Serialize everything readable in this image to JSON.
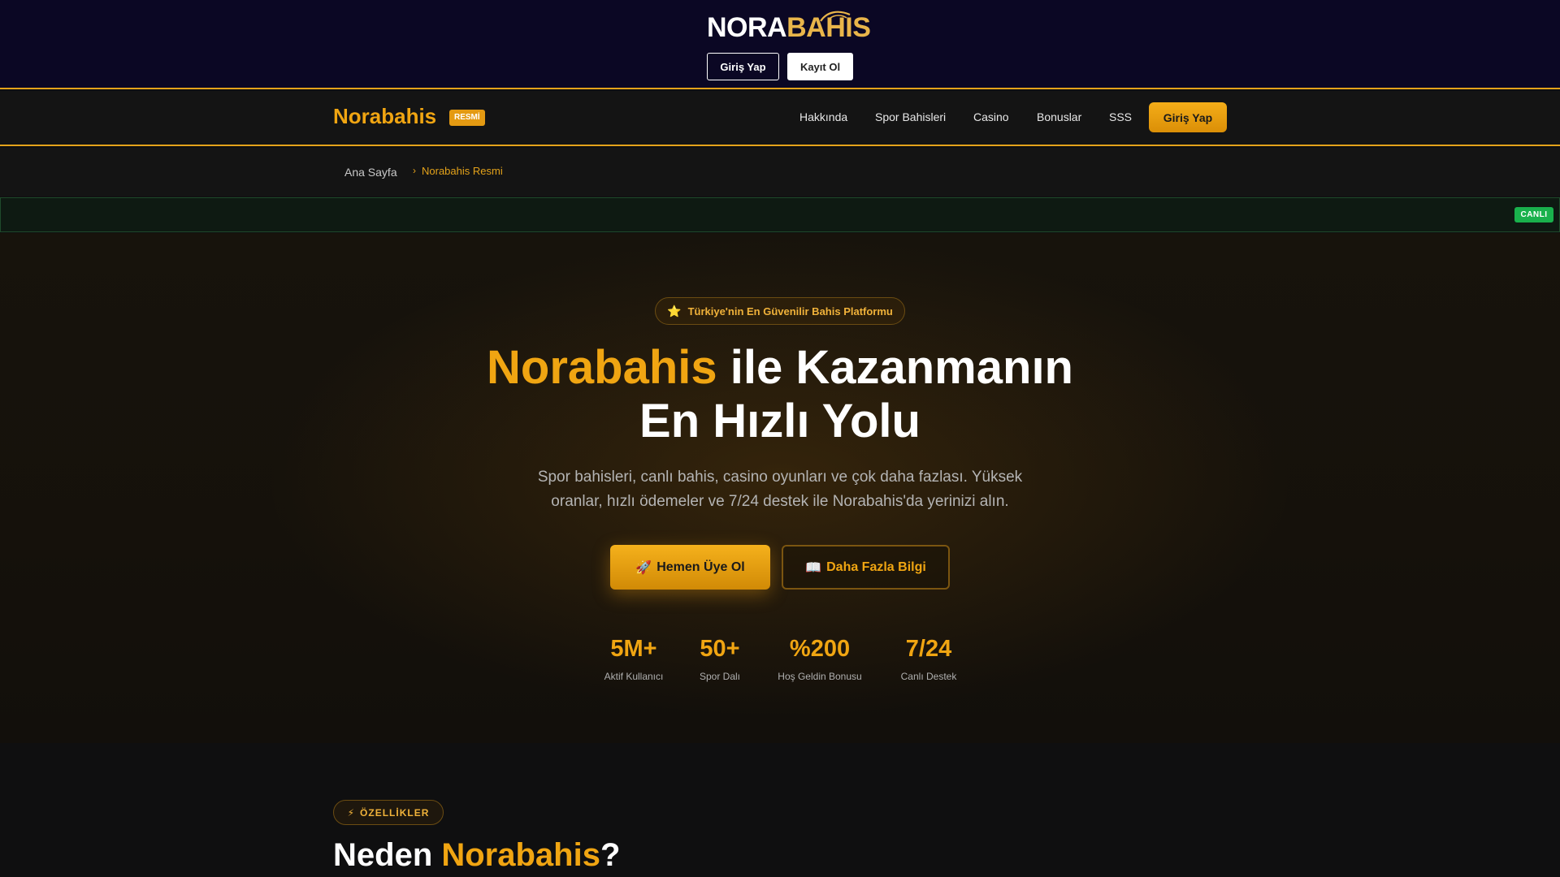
{
  "brand": {
    "logo_left": "NORA",
    "logo_right": "BAHIS",
    "login_label": "Giriş Yap",
    "register_label": "Kayıt Ol"
  },
  "nav": {
    "site_title": "Norabahis",
    "badge": "RESMİ",
    "links": [
      "Hakkında",
      "Spor Bahisleri",
      "Casino",
      "Bonuslar",
      "SSS"
    ],
    "cta_label": "Giriş Yap"
  },
  "breadcrumb": {
    "home": "Ana Sayfa",
    "separator": "›",
    "current": "Norabahis Resmi"
  },
  "ticker": {
    "live_badge": "CANLI"
  },
  "hero": {
    "pill_icon": "⭐",
    "pill_text": "Türkiye'nin En Güvenilir Bahis Platformu",
    "title_accent": "Norabahis",
    "title_line1_rest": " ile Kazanmanın",
    "title_line2": "En Hızlı Yolu",
    "subtitle": "Spor bahisleri, canlı bahis, casino oyunları ve çok daha fazlası. Yüksek oranlar, hızlı ödemeler ve 7/24 destek ile Norabahis'da yerinizi alın.",
    "primary_icon": "🚀",
    "primary_label": "Hemen Üye Ol",
    "secondary_icon": "📖",
    "secondary_label": "Daha Fazla Bilgi",
    "stats": [
      {
        "value": "5M+",
        "label": "Aktif Kullanıcı"
      },
      {
        "value": "50+",
        "label": "Spor Dalı"
      },
      {
        "value": "%200",
        "label": "Hoş Geldin Bonusu"
      },
      {
        "value": "7/24",
        "label": "Canlı Destek"
      }
    ]
  },
  "features": {
    "pill_icon": "⚡",
    "pill_text": "ÖZELLİKLER",
    "title_prefix": "Neden ",
    "title_accent": "Norabahis",
    "title_suffix": "?"
  },
  "colors": {
    "accent": "#f0a512",
    "brand_bar": "#0b0724",
    "live_green": "#19b14c"
  }
}
